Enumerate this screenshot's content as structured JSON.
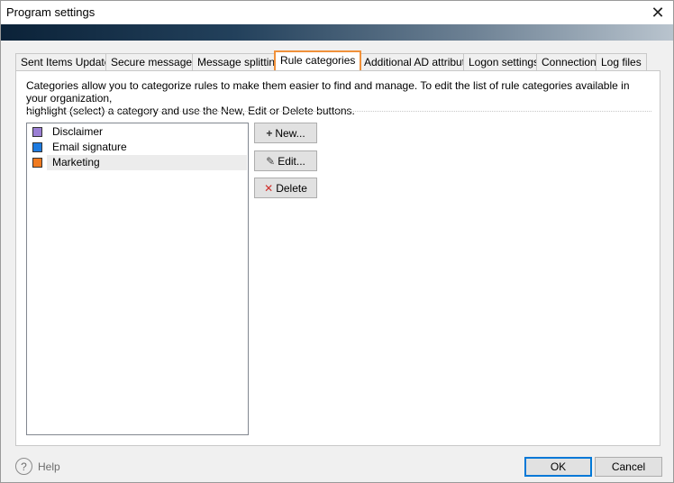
{
  "window": {
    "title": "Program settings"
  },
  "tabs": [
    {
      "label": "Sent Items Update"
    },
    {
      "label": "Secure messages"
    },
    {
      "label": "Message splitting"
    },
    {
      "label": "Rule categories"
    },
    {
      "label": "Additional AD attributes"
    },
    {
      "label": "Logon settings"
    },
    {
      "label": "Connection"
    },
    {
      "label": "Log files"
    }
  ],
  "active_tab": "Rule categories",
  "panel": {
    "description_line1": "Categories allow you to categorize rules to make them easier to find and manage. To edit the list of rule categories available in your organization,",
    "description_line2": "highlight (select) a category and use the New, Edit or Delete buttons."
  },
  "categories": [
    {
      "label": "Disclaimer",
      "color": "#9b7fd4"
    },
    {
      "label": "Email signature",
      "color": "#1e7be0"
    },
    {
      "label": "Marketing",
      "color": "#f07a1f"
    }
  ],
  "selected_category": "Marketing",
  "buttons": {
    "new_label": "New...",
    "edit_label": "Edit...",
    "delete_label": "Delete"
  },
  "footer": {
    "help_label": "Help",
    "ok_label": "OK",
    "cancel_label": "Cancel"
  }
}
